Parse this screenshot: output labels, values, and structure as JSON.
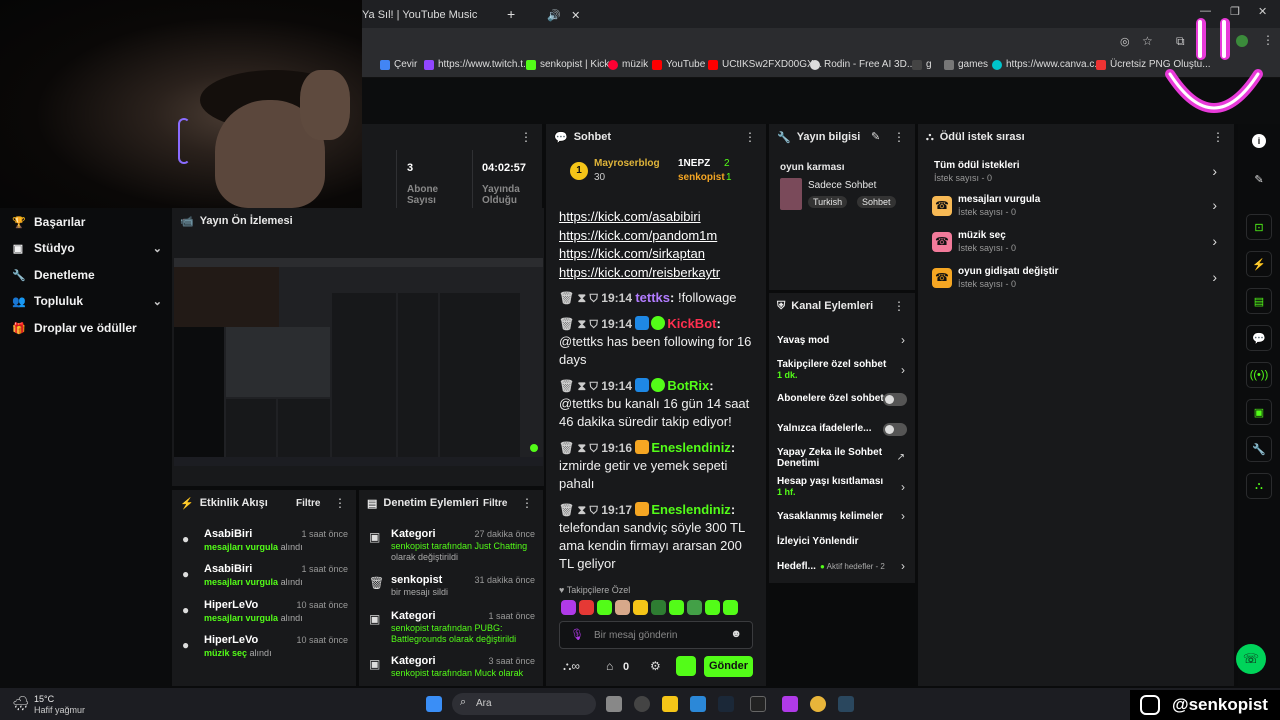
{
  "browser": {
    "active_tab": "Ya Sıl! | YouTube Music",
    "bookmarks": [
      {
        "label": "Çevir",
        "color": "#4285f4"
      },
      {
        "label": "https://www.twitch.t...",
        "color": "#9146ff"
      },
      {
        "label": "senkopist | Kick",
        "color": "#53fc18"
      },
      {
        "label": "müzik",
        "color": "#ff0033"
      },
      {
        "label": "YouTube",
        "color": "#ff0000"
      },
      {
        "label": "UCtIKSw2FXD00GX...",
        "color": "#ff0000"
      },
      {
        "label": "Rodin - Free AI 3D...",
        "color": "#dddddd"
      },
      {
        "label": "g",
        "color": "#111111"
      },
      {
        "label": "games",
        "color": "#777777"
      },
      {
        "label": "https://www.canva.c...",
        "color": "#00c4cc"
      },
      {
        "label": "Ücretsiz PNG Oluştu...",
        "color": "#e33"
      }
    ]
  },
  "stats": {
    "followers_value": "3",
    "followers_label": "Abone Sayısı",
    "uptime_value": "04:02:57",
    "uptime_label": "Yayında Olduğu"
  },
  "sidebar": {
    "items": [
      {
        "label": "Başarılar",
        "icon": "trophy-icon"
      },
      {
        "label": "Stüdyo",
        "icon": "studio-icon"
      },
      {
        "label": "Denetleme",
        "icon": "wrench-icon"
      },
      {
        "label": "Topluluk",
        "icon": "community-icon"
      },
      {
        "label": "Droplar ve ödüller",
        "icon": "gift-icon"
      }
    ]
  },
  "preview": {
    "title": "Yayın Ön İzlemesi"
  },
  "activity": {
    "title": "Etkinlik Akışı",
    "filter": "Filtre",
    "items": [
      {
        "name": "AsabiBiri",
        "time": "1 saat önce",
        "reward": "mesajları vurgula",
        "suffix": "alındı"
      },
      {
        "name": "AsabiBiri",
        "time": "1 saat önce",
        "reward": "mesajları vurgula",
        "suffix": "alındı"
      },
      {
        "name": "HiperLeVo",
        "time": "10 saat önce",
        "reward": "mesajları vurgula",
        "suffix": "alındı"
      },
      {
        "name": "HiperLeVo",
        "time": "10 saat önce",
        "reward": "müzik seç",
        "suffix": "alındı"
      }
    ]
  },
  "modactions": {
    "title": "Denetim Eylemleri",
    "filter": "Filtre",
    "items": [
      {
        "name": "Kategori",
        "time": "27 dakika önce",
        "line1": "senkopist tarafından Just Chatting",
        "line2": "olarak değiştirildi"
      },
      {
        "name": "senkopist",
        "time": "31 dakika önce",
        "line1": "bir mesajı sildi",
        "line2": ""
      },
      {
        "name": "Kategori",
        "time": "1 saat önce",
        "line1": "senkopist tarafından PUBG:",
        "line2": "Battlegrounds olarak değiştirildi"
      },
      {
        "name": "Kategori",
        "time": "3 saat önce",
        "line1": "senkopist tarafından Muck olarak",
        "line2": ""
      }
    ]
  },
  "chat": {
    "title": "Sohbet",
    "leaders": [
      {
        "name": "Mayroserblog",
        "count": "30"
      },
      {
        "name": "1NEPZ",
        "count": "2"
      },
      {
        "name": "senkopist",
        "count": "1"
      }
    ],
    "links": [
      "https://kick.com/asabibiri",
      "https://kick.com/pandom1m",
      "https://kick.com/sirkaptan",
      "https://kick.com/reisberkaytr"
    ],
    "messages": [
      {
        "time": "19:14",
        "user": "tettks",
        "color": "#b27cff",
        "text": "!followage"
      },
      {
        "time": "19:14",
        "user": "KickBot",
        "color": "#ff2f4f",
        "text": "@tettks has been following for 16 days"
      },
      {
        "time": "19:14",
        "user": "BotRix",
        "color": "#53fc18",
        "text": "@tettks bu kanalı 16 gün 14 saat 46 dakika süredir takip ediyor!"
      },
      {
        "time": "19:16",
        "user": "Eneslendiniz",
        "color": "#53fc18",
        "text": "izmirde getir ve yemek sepeti pahalı"
      },
      {
        "time": "19:17",
        "user": "Eneslendiniz",
        "color": "#53fc18",
        "text": "telefondan sandviç söyle 300 TL ama kendin firmayı ararsan 200 TL geliyor"
      }
    ],
    "followers_only": "Takipçilere Özel",
    "placeholder": "Bir mesaj gönderin",
    "points": "0",
    "send": "Gönder"
  },
  "streaminfo": {
    "title": "Yayın bilgisi",
    "stream_title": "oyun karması",
    "category": "Sadece Sohbet",
    "tags": [
      "Turkish",
      "Sohbet"
    ]
  },
  "channel": {
    "title": "Kanal Eylemleri",
    "items": [
      {
        "label": "Yavaş mod",
        "sub": ""
      },
      {
        "label": "Takipçilere özel sohbet",
        "sub": "1 dk."
      },
      {
        "label": "Abonelere özel sohbet",
        "sub": ""
      },
      {
        "label": "Yalnızca ifadelerle...",
        "sub": ""
      },
      {
        "label": "Yapay Zeka ile Sohbet Denetimi",
        "sub": ""
      },
      {
        "label": "Hesap yaşı kısıtlaması",
        "sub": "1 hf."
      },
      {
        "label": "Yasaklanmış kelimeler",
        "sub": ""
      },
      {
        "label": "İzleyici Yönlendir",
        "sub": ""
      },
      {
        "label": "Hedefl...",
        "sub": ""
      }
    ],
    "goals_badge": "Aktif hedefler - 2"
  },
  "rewards": {
    "title": "Ödül istek sırası",
    "all": "Tüm ödül istekleri",
    "all_count": "İstek sayısı - 0",
    "items": [
      {
        "name": "mesajları vurgula",
        "count": "İstek sayısı - 0",
        "color": "#f7b955"
      },
      {
        "name": "müzik seç",
        "count": "İstek sayısı - 0",
        "color": "#f27a9a"
      },
      {
        "name": "oyun gidişatı değiştir",
        "count": "İstek sayısı - 0",
        "color": "#f5a623"
      }
    ]
  },
  "taskbar": {
    "weather_temp": "15°C",
    "weather_desc": "Hafif yağmur",
    "search": "Ara",
    "handle": "@senkopist"
  }
}
